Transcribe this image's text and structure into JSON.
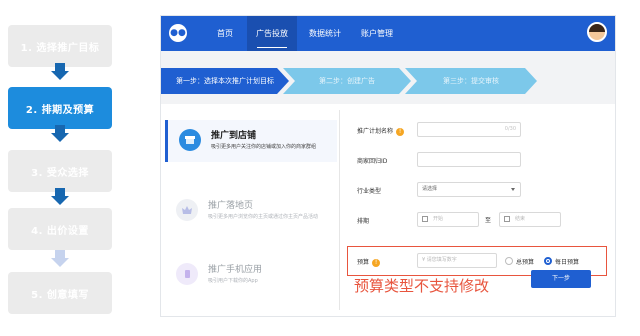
{
  "steps": [
    {
      "label": "1. 选择推广目标",
      "state": "inactive"
    },
    {
      "label": "2. 排期及预算",
      "state": "active"
    },
    {
      "label": "3. 受众选择",
      "state": "inactive"
    },
    {
      "label": "4. 出价设置",
      "state": "inactive"
    },
    {
      "label": "5. 创意填写",
      "state": "inactive"
    }
  ],
  "app": {
    "logo": "●●",
    "nav": [
      "首页",
      "广告投放",
      "数据统计",
      "账户管理"
    ],
    "active_nav": "广告投放",
    "progress": [
      {
        "label": "第一步：选择本次推广计划目标",
        "state": "on"
      },
      {
        "label": "第二步：创建广告",
        "state": "off"
      },
      {
        "label": "第三步：提交审核",
        "state": "off"
      }
    ],
    "goals": [
      {
        "title": "推广到店铺",
        "desc": "吸引更多用户关注你的店铺或加入你的商家群组",
        "icon": "store-icon",
        "active": true
      },
      {
        "title": "推广落地页",
        "desc": "吸引更多用户浏览你的主页或通过你主页产品活动",
        "icon": "crown-icon",
        "active": false
      },
      {
        "title": "推广手机应用",
        "desc": "吸引用户下载你的App",
        "icon": "phone-icon",
        "active": false
      }
    ],
    "form": {
      "plan_name_label": "推广计划名称",
      "plan_name_counter": "0/30",
      "plan_id_label": "商家回归ID",
      "industry_label": "行业类型",
      "industry_placeholder": "请选择",
      "schedule_label": "排期",
      "start_placeholder": "开始",
      "schedule_sep": "至",
      "end_placeholder": "结束",
      "budget_label": "预算",
      "budget_placeholder": "¥  请您填写数字",
      "budget_options": [
        {
          "label": "总预算",
          "selected": false
        },
        {
          "label": "每日预算",
          "selected": true
        }
      ]
    },
    "next_button": "下一步",
    "note": "预算类型不支持修改"
  },
  "colors": {
    "primary": "#1f5fd1",
    "step_active": "#1d8cdd",
    "step_inactive": "#ebebeb",
    "highlight": "#e8553e"
  }
}
